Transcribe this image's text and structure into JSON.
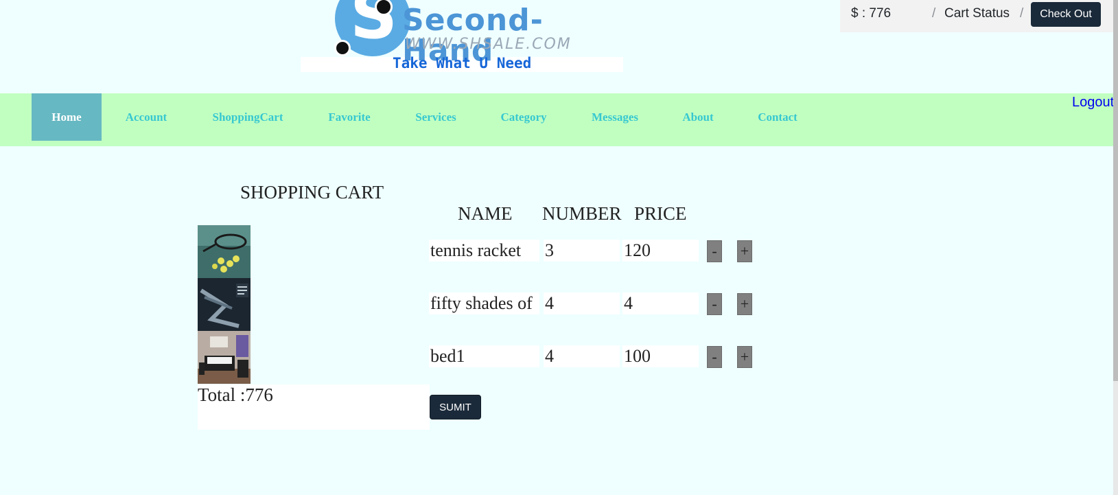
{
  "brand": {
    "name": "Second-Hand",
    "url": "WWW.SHSALE.COM",
    "tagline": "Take What U Need",
    "colors": {
      "blue": "#5aabe3",
      "tagline": "#1666d8"
    }
  },
  "status": {
    "money": "$ : 776",
    "separator": "/",
    "cart_status": "Cart Status",
    "checkout_label": "Check Out"
  },
  "nav": {
    "items": [
      {
        "label": "Home",
        "active": true
      },
      {
        "label": "Account"
      },
      {
        "label": "ShoppingCart"
      },
      {
        "label": "Favorite"
      },
      {
        "label": "Services"
      },
      {
        "label": "Category"
      },
      {
        "label": "Messages"
      },
      {
        "label": "About"
      },
      {
        "label": "Contact"
      }
    ],
    "logout": "Logout",
    "colors": {
      "bar": "#c1ffc1",
      "active": "#66b8c2",
      "link": "#37c8d0"
    }
  },
  "cart": {
    "title": "SHOPPING CART",
    "headers": {
      "name": "NAME",
      "number": "NUMBER",
      "price": "PRICE"
    },
    "items": [
      {
        "name": "tennis racket",
        "number": "3",
        "price": "120",
        "image": "tennis-racket-image"
      },
      {
        "name": "fifty shades of",
        "number": "4",
        "price": "4",
        "image": "book-cover-image"
      },
      {
        "name": "bed1",
        "number": "4",
        "price": "100",
        "image": "bedroom-image"
      }
    ],
    "minus": "-",
    "plus": "+",
    "total": "Total :776",
    "submit": "SUMIT"
  }
}
